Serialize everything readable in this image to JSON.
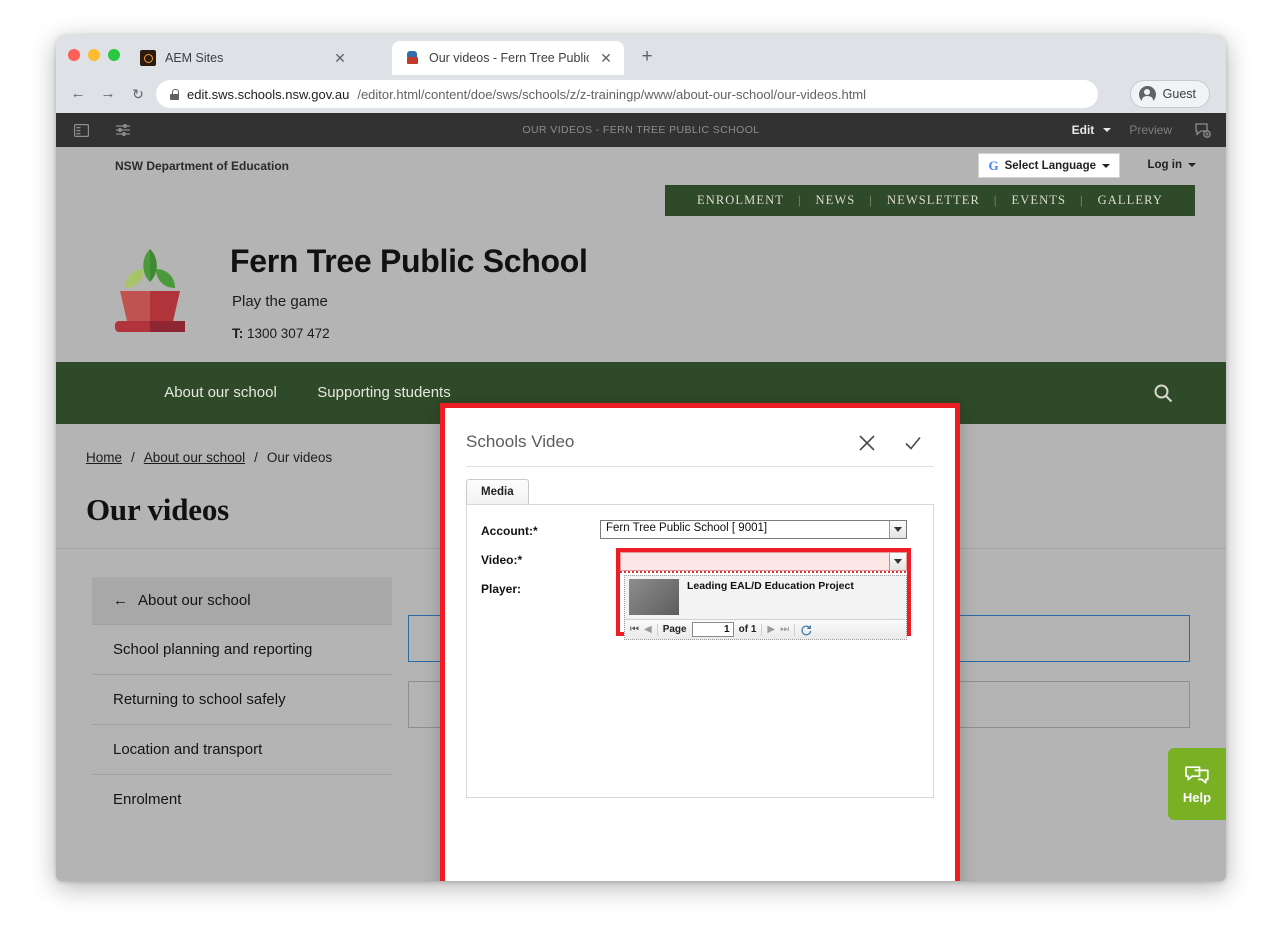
{
  "browser": {
    "tabs": [
      {
        "title": "AEM Sites",
        "icon": "aem-favicon",
        "active": false,
        "close_label": "✕"
      },
      {
        "title": "Our videos - Fern Tree Public S",
        "icon": "school-favicon",
        "active": true,
        "close_label": "✕"
      }
    ],
    "new_tab_label": "+",
    "nav": {
      "back": "←",
      "forward": "→",
      "reload": "↻"
    },
    "url_secure_part": "edit.sws.schools.nsw.gov.au",
    "url_path_part": "/editor.html/content/doe/sws/schools/z/z-trainingp/www/about-our-school/our-videos.html",
    "profile_label": "Guest"
  },
  "aem_bar": {
    "title": "OUR VIDEOS - FERN TREE PUBLIC SCHOOL",
    "sidebar_toggle_icon": "sidebar-panel-icon",
    "page_properties_icon": "sliders-settings-icon",
    "edit_label": "Edit",
    "preview_label": "Preview",
    "annotations_icon": "annotations-icon"
  },
  "utility_bar": {
    "department": "NSW Department of Education",
    "language_selector": "Select Language",
    "language_icon": "google-g-icon",
    "login_label": "Log in"
  },
  "quick_links": [
    "ENROLMENT",
    "NEWS",
    "NEWSLETTER",
    "EVENTS",
    "GALLERY"
  ],
  "masthead": {
    "logo_icon": "plant-in-pot-logo",
    "school_name": "Fern Tree Public School",
    "tagline": "Play the game",
    "phone_prefix": "T:",
    "phone": "1300 307 472"
  },
  "main_nav": {
    "items": [
      "About our school",
      "Supporting students"
    ],
    "search_icon": "search-icon"
  },
  "breadcrumb": {
    "items": [
      "Home",
      "About our school",
      "Our videos"
    ],
    "separator": "/"
  },
  "page_title": "Our videos",
  "side_menu": {
    "back_icon": "arrow-left-icon",
    "back_label": "About our school",
    "items": [
      "School planning and reporting",
      "Returning to school safely",
      "Location and transport",
      "Enrolment"
    ]
  },
  "help_widget": {
    "icon": "speech-bubble-icon",
    "label": "Help",
    "color": "#7ab024"
  },
  "dialog": {
    "title": "Schools Video",
    "cancel_icon": "close-icon",
    "confirm_icon": "check-icon",
    "tabs": [
      "Media"
    ],
    "fields": {
      "account_label": "Account:*",
      "account_value": "Fern Tree Public School [              9001]",
      "video_label": "Video:*",
      "video_value": "",
      "player_label": "Player:"
    },
    "dropdown": {
      "open": true,
      "items": [
        {
          "title": "Leading EAL/D Education Project",
          "thumbnail": "video-thumbnail"
        }
      ],
      "pager": {
        "first_icon": "⏮",
        "prev_icon": "◀",
        "page_label": "Page",
        "page_value": "1",
        "of_label": "of 1",
        "next_icon": "▶",
        "last_icon": "⏭",
        "refresh_icon": "refresh-icon"
      }
    }
  },
  "colors": {
    "school_green": "#2f4a28",
    "highlight_red": "#ee1c25",
    "help_green": "#7ab024",
    "selected_component_blue": "#2a6ca8"
  }
}
